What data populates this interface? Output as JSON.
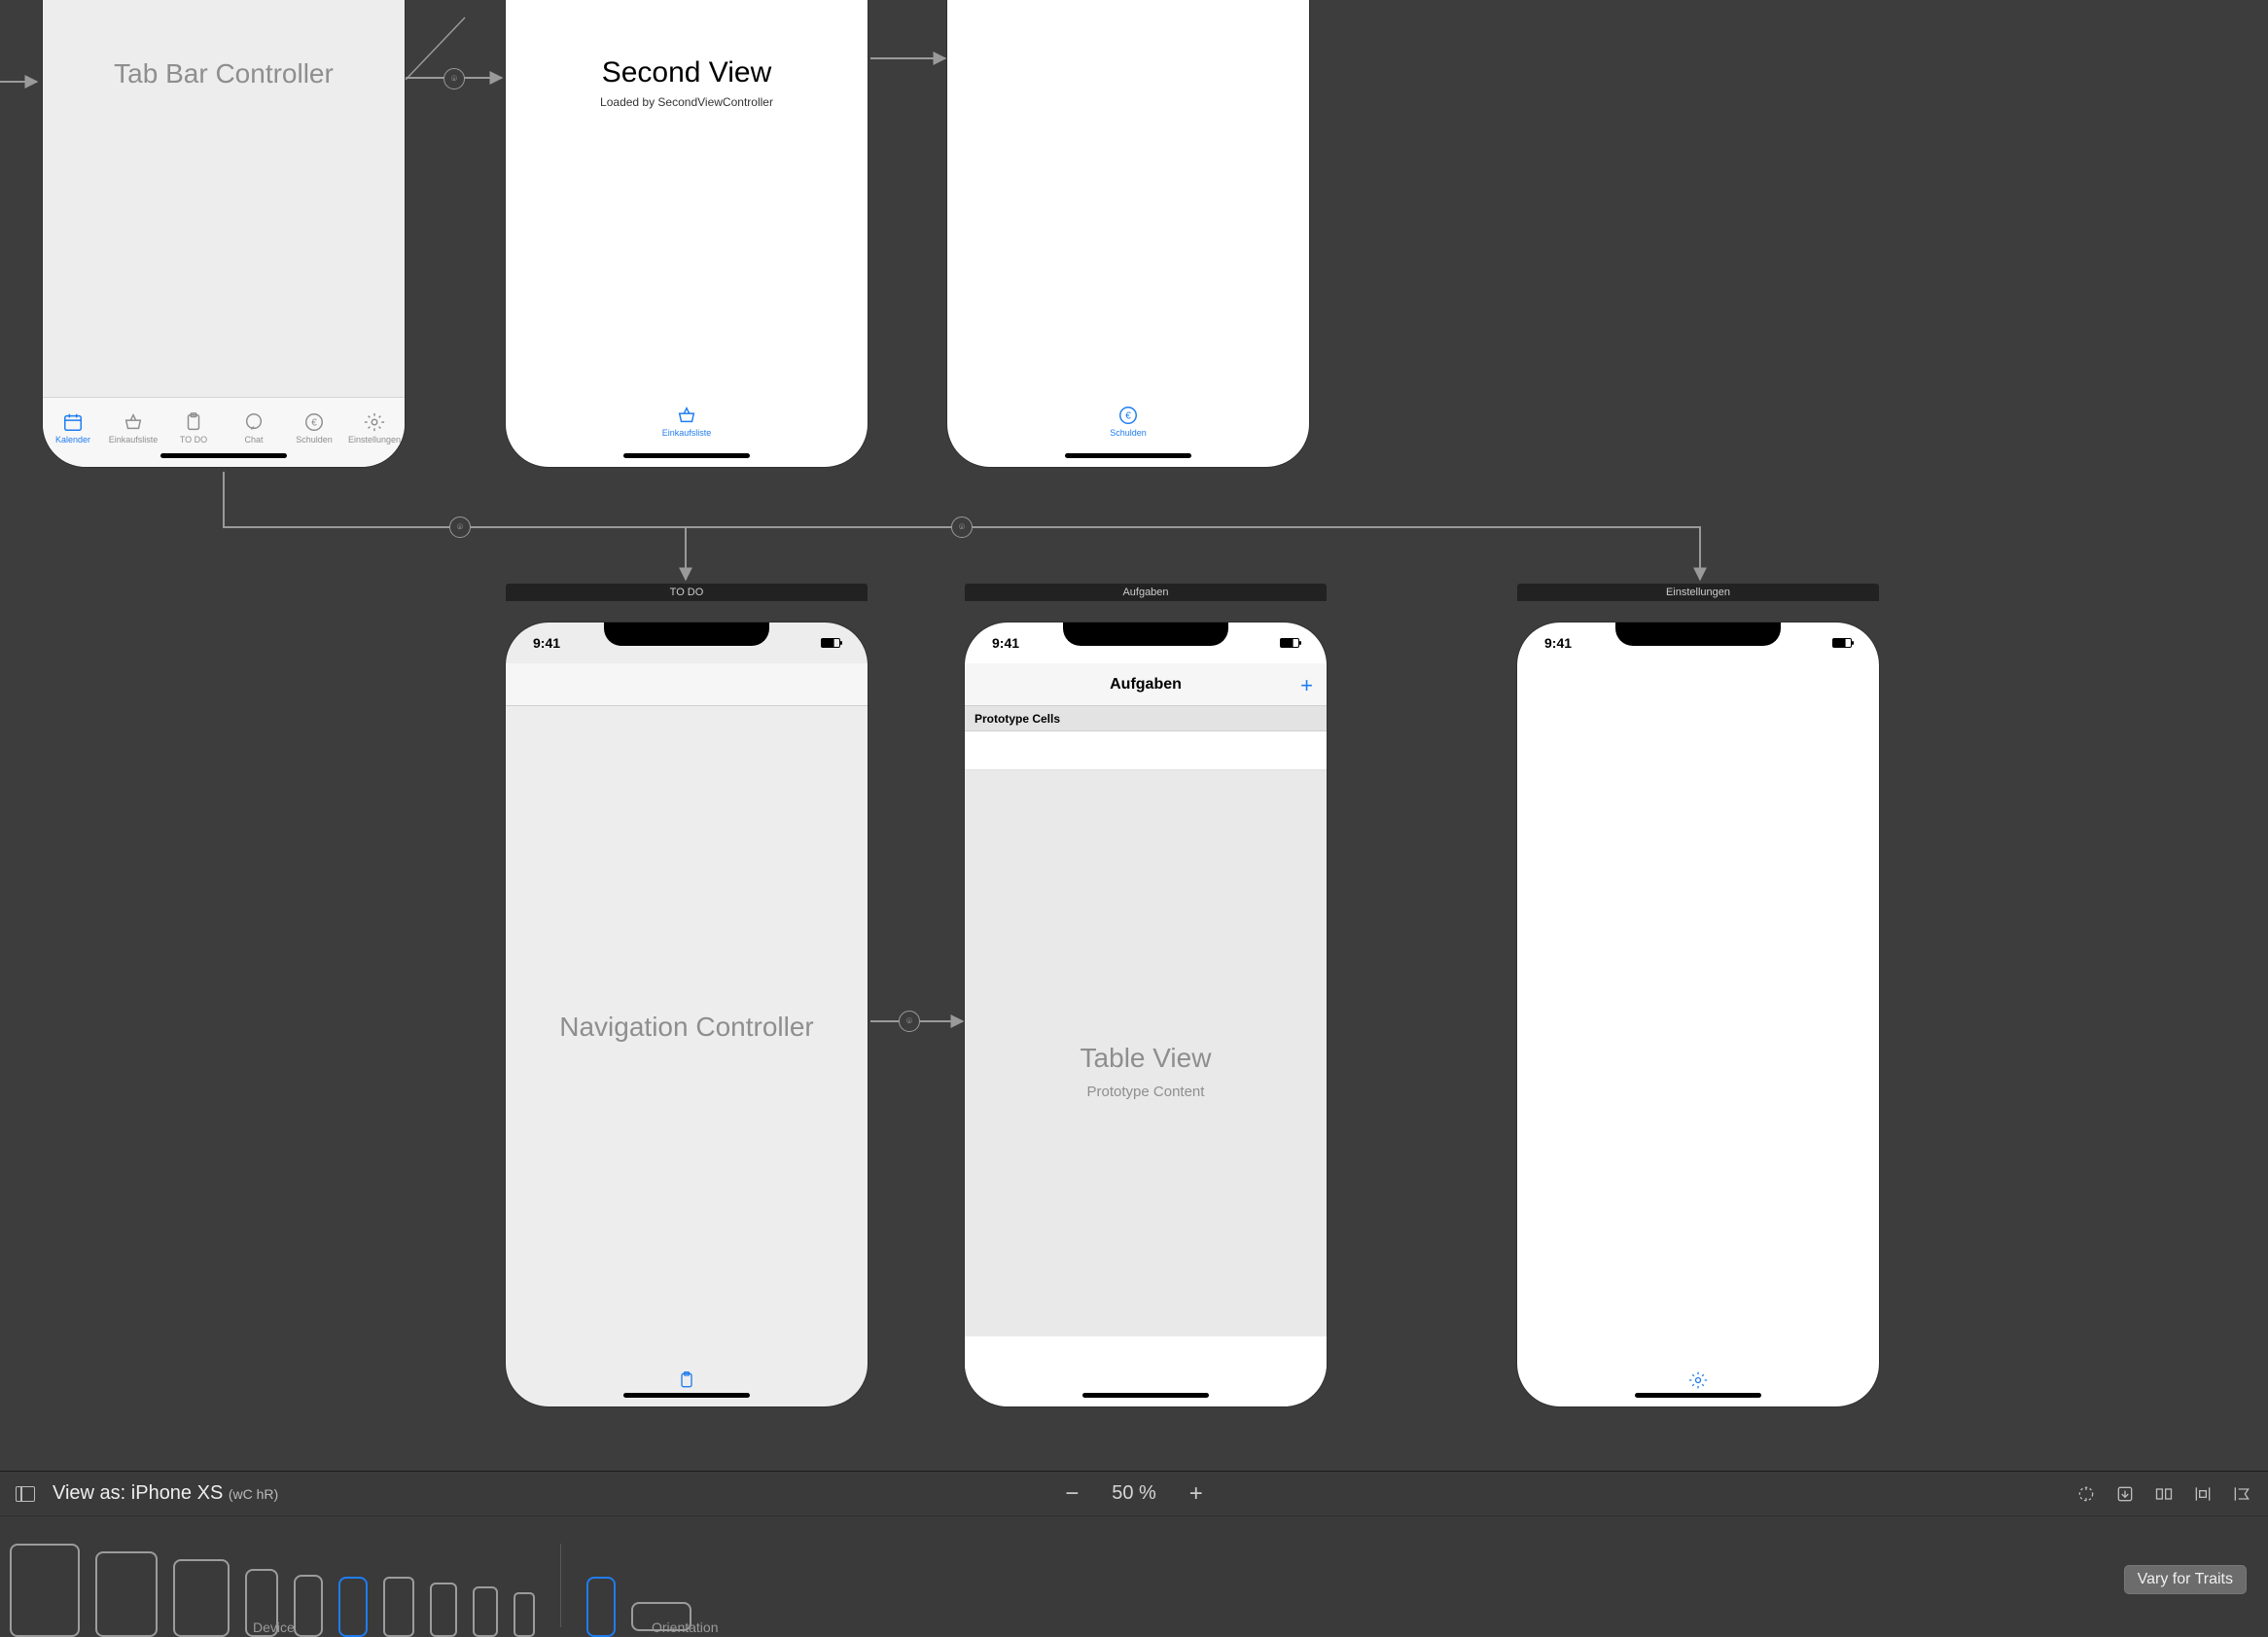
{
  "scenes": {
    "tab_bar_controller": {
      "title": "Tab Bar Controller",
      "tabs": [
        {
          "label": "Kalender"
        },
        {
          "label": "Einkaufsliste"
        },
        {
          "label": "TO DO"
        },
        {
          "label": "Chat"
        },
        {
          "label": "Schulden"
        },
        {
          "label": "Einstellungen"
        }
      ]
    },
    "second_view": {
      "title": "Second View",
      "subtitle": "Loaded by SecondViewController",
      "tab_label": "Einkaufsliste"
    },
    "schulden_view": {
      "tab_label": "Schulden"
    },
    "nav_controller": {
      "bar_title": "TO DO",
      "body_title": "Navigation Controller",
      "status_time": "9:41"
    },
    "aufgaben": {
      "bar_title": "Aufgaben",
      "nav_title": "Aufgaben",
      "status_time": "9:41",
      "prototype_header": "Prototype Cells",
      "table_title": "Table View",
      "table_subtitle": "Prototype Content"
    },
    "einstellungen": {
      "bar_title": "Einstellungen",
      "status_time": "9:41"
    }
  },
  "device_bar": {
    "view_as_label": "View as: iPhone XS",
    "size_class": "(wC hR)",
    "zoom": "50 %",
    "device_caption": "Device",
    "orientation_caption": "Orientation",
    "vary_button": "Vary for Traits"
  }
}
